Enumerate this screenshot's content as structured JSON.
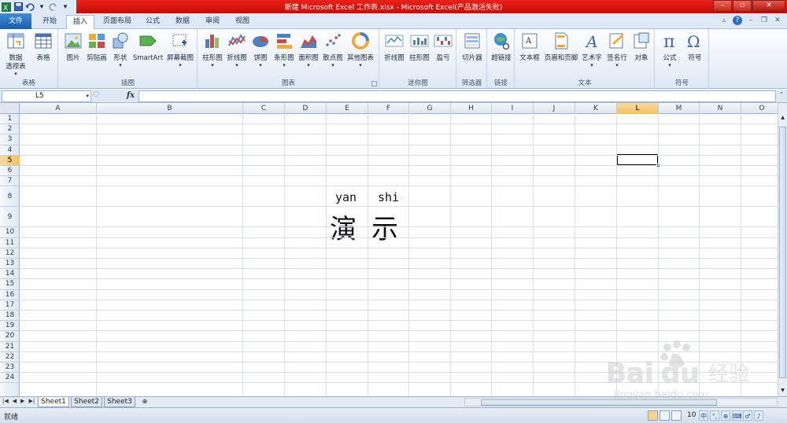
{
  "window": {
    "title": "新建 Microsoft Excel 工作表.xlsx - Microsoft Excel(产品激活失败)"
  },
  "tabs": [
    {
      "label": "文件"
    },
    {
      "label": "开始"
    },
    {
      "label": "插入"
    },
    {
      "label": "页面布局"
    },
    {
      "label": "公式"
    },
    {
      "label": "数据"
    },
    {
      "label": "审阅"
    },
    {
      "label": "视图"
    }
  ],
  "ribbon": {
    "groups": {
      "tables": "表格",
      "illustrations": "插图",
      "charts": "图表",
      "sparklines": "迷你图",
      "filter": "筛选器",
      "links": "链接",
      "text": "文本",
      "symbols": "符号"
    },
    "buttons": {
      "pivot1": "数据",
      "pivot2": "透视表",
      "table": "表格",
      "picture": "图片",
      "clipart": "剪贴画",
      "shapes": "形状",
      "smartart": "SmartArt",
      "screenshot": "屏幕截图",
      "column": "柱形图",
      "line": "折线图",
      "pie": "饼图",
      "bar": "条形图",
      "area": "面积图",
      "scatter": "散点图",
      "other": "其他图表",
      "spark_line": "折线图",
      "spark_column": "柱形图",
      "spark_winloss": "盈亏",
      "slicer": "切片器",
      "hyperlink": "超链接",
      "textbox": "文本框",
      "headerfooter": "页眉和页脚",
      "wordart": "艺术字",
      "signature": "签名行",
      "object": "对象",
      "equation": "公式",
      "symbol": "符号"
    }
  },
  "formula_bar": {
    "name_box": "L5",
    "fx": "fx",
    "content": ""
  },
  "grid": {
    "columns": [
      "A",
      "B",
      "C",
      "D",
      "E",
      "F",
      "G",
      "H",
      "I",
      "J",
      "K",
      "L",
      "M",
      "N",
      "O"
    ],
    "rows": [
      "1",
      "2",
      "3",
      "4",
      "5",
      "6",
      "7",
      "8",
      "9",
      "10",
      "11",
      "12",
      "13",
      "14",
      "15",
      "16",
      "17",
      "18",
      "19",
      "20",
      "21",
      "22",
      "23",
      "24"
    ],
    "selected_cell": "L5",
    "cells": {
      "e8": "yan",
      "f8": "shi",
      "e9": "演",
      "f9": "示"
    }
  },
  "sheets": [
    {
      "label": "Sheet1"
    },
    {
      "label": "Sheet2"
    },
    {
      "label": "Sheet3"
    }
  ],
  "status": {
    "ready": "就绪",
    "zoom": "10"
  },
  "ime": [
    "中",
    "°,",
    "⊕",
    "⌨",
    "♂",
    "♪"
  ],
  "watermark": {
    "brand": "Bai du 经验",
    "url": "jingyan.baidu.com"
  },
  "colors": {
    "title_bar": "#d7140c",
    "file_tab": "#2a6fc0",
    "selection_header": "#f5c86a",
    "ribbon_bg": "#dde8f5"
  }
}
